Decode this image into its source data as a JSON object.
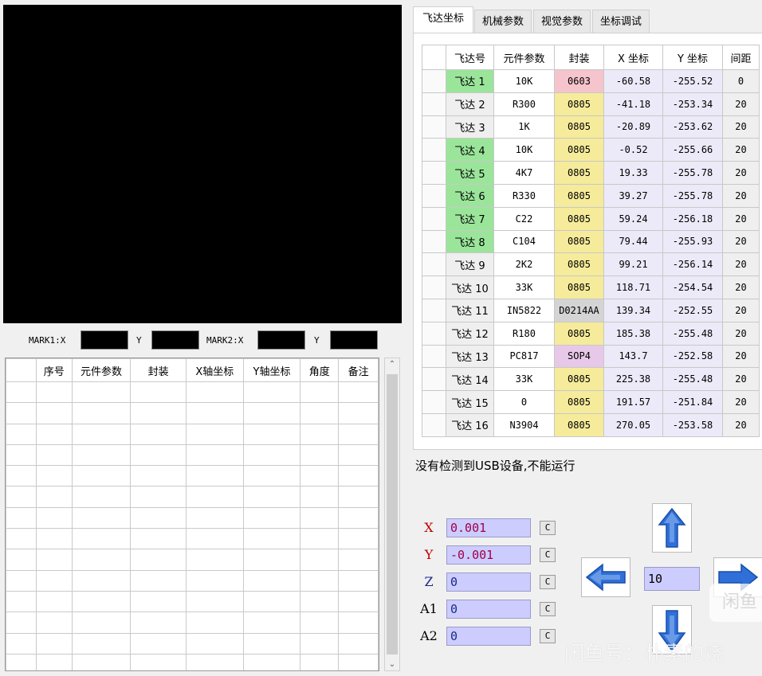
{
  "mark": {
    "mark1_x": "MARK1:X",
    "mark1_y": "Y",
    "mark2_x": "MARK2:X",
    "mark2_y": "Y"
  },
  "left_table": {
    "headers": [
      "",
      "序号",
      "元件参数",
      "封装",
      "X轴坐标",
      "Y轴坐标",
      "角度",
      "备注"
    ],
    "scroll_up": "⌃",
    "scroll_down": "⌄"
  },
  "tabs": [
    "飞达坐标",
    "机械参数",
    "视觉参数",
    "坐标调试"
  ],
  "feeder_table": {
    "headers": [
      "",
      "飞达号",
      "元件参数",
      "封装",
      "X 坐标",
      "Y 坐标",
      "间距"
    ],
    "rows": [
      {
        "name": "飞达 1",
        "param": "10K",
        "pkg": "0603",
        "x": "-60.58",
        "y": "-255.52",
        "gap": "0",
        "name_color": "green",
        "pkg_color": "pink"
      },
      {
        "name": "飞达 2",
        "param": "R300",
        "pkg": "0805",
        "x": "-41.18",
        "y": "-253.34",
        "gap": "20",
        "name_color": "gray",
        "pkg_color": "yellow"
      },
      {
        "name": "飞达 3",
        "param": "1K",
        "pkg": "0805",
        "x": "-20.89",
        "y": "-253.62",
        "gap": "20",
        "name_color": "gray",
        "pkg_color": "yellow"
      },
      {
        "name": "飞达 4",
        "param": "10K",
        "pkg": "0805",
        "x": "-0.52",
        "y": "-255.66",
        "gap": "20",
        "name_color": "green",
        "pkg_color": "yellow"
      },
      {
        "name": "飞达 5",
        "param": "4K7",
        "pkg": "0805",
        "x": "19.33",
        "y": "-255.78",
        "gap": "20",
        "name_color": "green",
        "pkg_color": "yellow"
      },
      {
        "name": "飞达 6",
        "param": "R330",
        "pkg": "0805",
        "x": "39.27",
        "y": "-255.78",
        "gap": "20",
        "name_color": "green",
        "pkg_color": "yellow"
      },
      {
        "name": "飞达 7",
        "param": "C22",
        "pkg": "0805",
        "x": "59.24",
        "y": "-256.18",
        "gap": "20",
        "name_color": "green",
        "pkg_color": "yellow"
      },
      {
        "name": "飞达 8",
        "param": "C104",
        "pkg": "0805",
        "x": "79.44",
        "y": "-255.93",
        "gap": "20",
        "name_color": "green",
        "pkg_color": "yellow"
      },
      {
        "name": "飞达 9",
        "param": "2K2",
        "pkg": "0805",
        "x": "99.21",
        "y": "-256.14",
        "gap": "20",
        "name_color": "gray",
        "pkg_color": "yellow"
      },
      {
        "name": "飞达 10",
        "param": "33K",
        "pkg": "0805",
        "x": "118.71",
        "y": "-254.54",
        "gap": "20",
        "name_color": "gray",
        "pkg_color": "yellow"
      },
      {
        "name": "飞达 11",
        "param": "IN5822",
        "pkg": "D0214AA",
        "x": "139.34",
        "y": "-252.55",
        "gap": "20",
        "name_color": "gray",
        "pkg_color": "gray"
      },
      {
        "name": "飞达 12",
        "param": "R180",
        "pkg": "0805",
        "x": "185.38",
        "y": "-255.48",
        "gap": "20",
        "name_color": "gray",
        "pkg_color": "yellow"
      },
      {
        "name": "飞达 13",
        "param": "PC817",
        "pkg": "SOP4",
        "x": "143.7",
        "y": "-252.58",
        "gap": "20",
        "name_color": "gray",
        "pkg_color": "lilac"
      },
      {
        "name": "飞达 14",
        "param": "33K",
        "pkg": "0805",
        "x": "225.38",
        "y": "-255.48",
        "gap": "20",
        "name_color": "gray",
        "pkg_color": "yellow"
      },
      {
        "name": "飞达 15",
        "param": "0",
        "pkg": "0805",
        "x": "191.57",
        "y": "-251.84",
        "gap": "20",
        "name_color": "gray",
        "pkg_color": "yellow"
      },
      {
        "name": "飞达 16",
        "param": "N3904",
        "pkg": "0805",
        "x": "270.05",
        "y": "-253.58",
        "gap": "20",
        "name_color": "gray",
        "pkg_color": "yellow"
      }
    ]
  },
  "status_text": "没有检测到USB设备,不能运行",
  "axes": [
    {
      "label": "X",
      "value": "0.001",
      "label_color": "#c00000",
      "value_color": "#a0004a"
    },
    {
      "label": "Y",
      "value": "-0.001",
      "label_color": "#c00000",
      "value_color": "#a0004a"
    },
    {
      "label": "Z",
      "value": "0",
      "label_color": "#1a2a8a",
      "value_color": "#1a2a8a"
    },
    {
      "label": "A1",
      "value": "0",
      "label_color": "#000000",
      "value_color": "#1a2a8a"
    },
    {
      "label": "A2",
      "value": "0",
      "label_color": "#000000",
      "value_color": "#1a2a8a"
    }
  ],
  "clear_label": "C",
  "step_value": "10",
  "watermark": "闲鱼号：朴素的烧",
  "watermark_badge": "闲鱼",
  "colors": {
    "arrow_blue": "#2f6fd8",
    "green_cell": "#9be59b",
    "yellow_cell": "#f5eb9a",
    "pink_cell": "#f5c4cc"
  }
}
